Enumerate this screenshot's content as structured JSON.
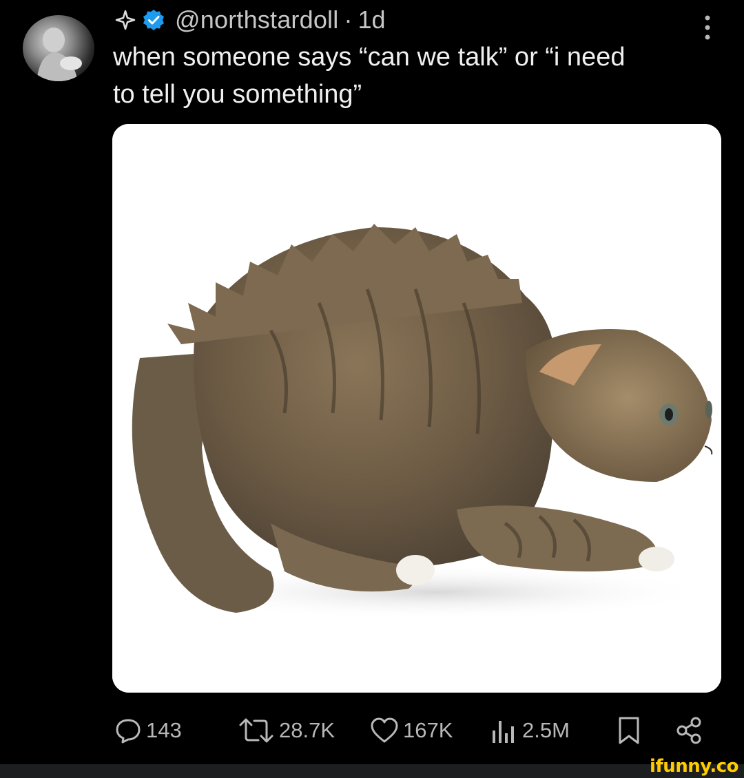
{
  "post": {
    "handle": "@northstardoll",
    "separator": "·",
    "age": "1d",
    "text_lines": [
      "when someone says “can we talk” or “i need",
      "to tell you something”"
    ]
  },
  "actions": {
    "replies": "143",
    "reposts": "28.7K",
    "likes": "167K",
    "views": "2.5M"
  },
  "watermark": "ifunny.co",
  "colors": {
    "background": "#000000",
    "verified_badge": "#1d9bf0",
    "icon_gray": "#b8b8b8",
    "watermark": "#ffcc00"
  },
  "icons": [
    "sparkle-icon",
    "verified-badge-icon",
    "more-icon",
    "reply-icon",
    "repost-icon",
    "like-icon",
    "views-icon",
    "bookmark-icon",
    "share-icon"
  ]
}
